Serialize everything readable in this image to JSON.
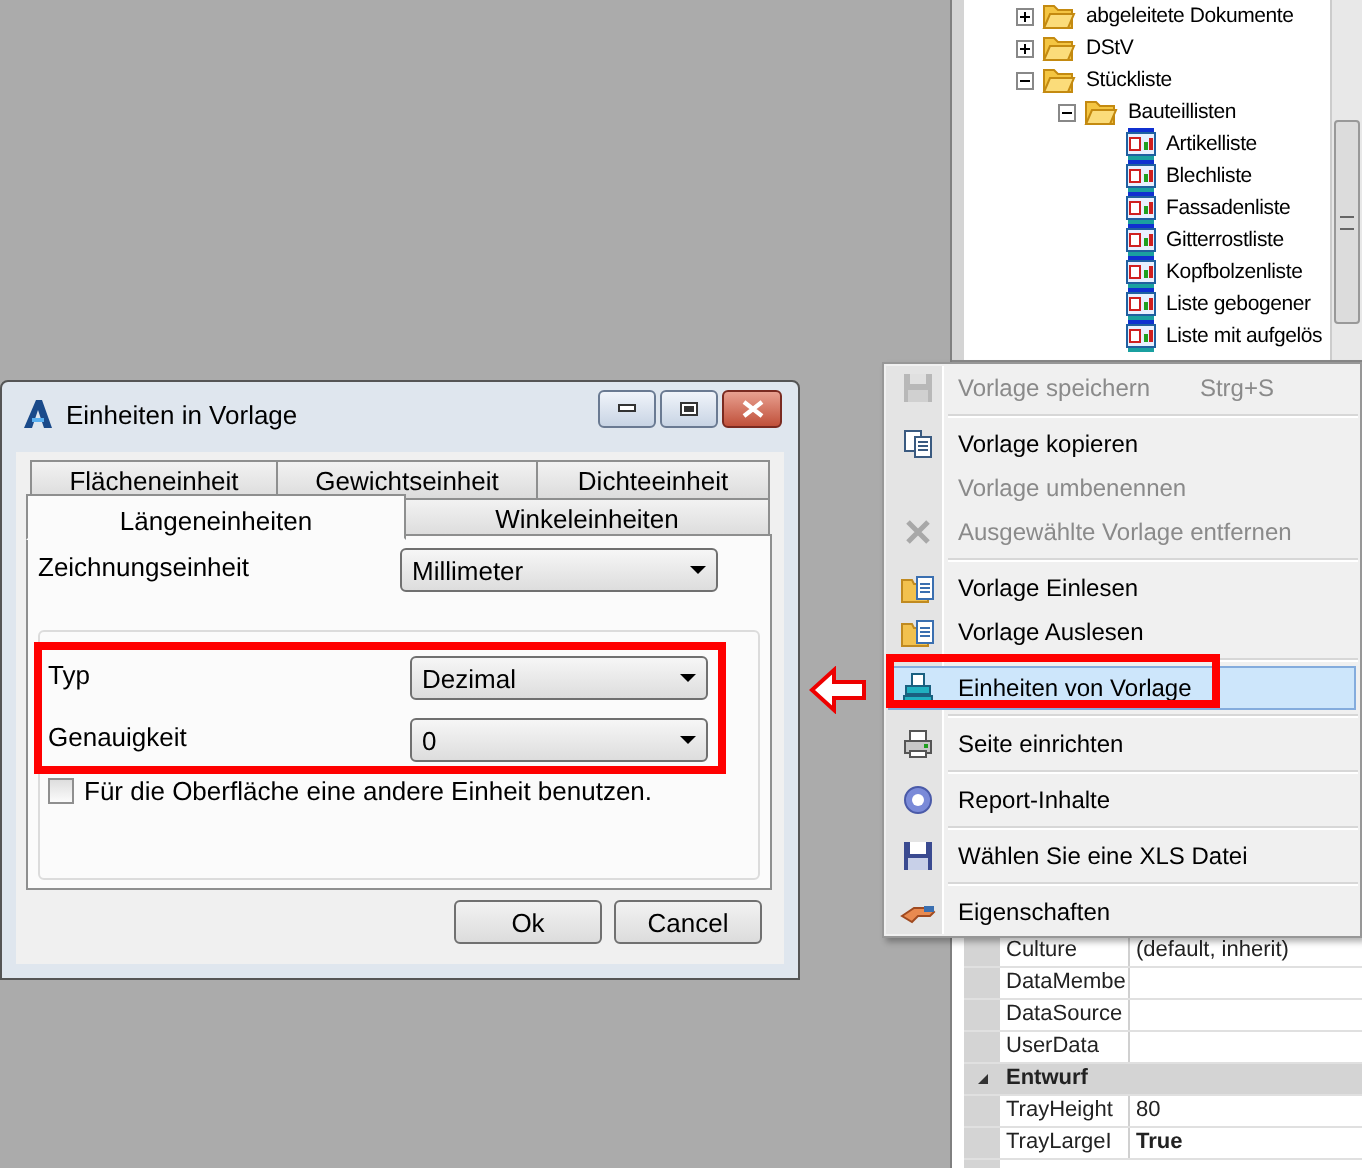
{
  "tree": {
    "items": [
      {
        "label": "abgeleitete Dokumente",
        "expanded": false
      },
      {
        "label": "DStV",
        "expanded": false
      },
      {
        "label": "Stückliste",
        "expanded": true,
        "children": [
          {
            "label": "Bauteillisten",
            "expanded": true,
            "children": [
              {
                "label": "Artikelliste"
              },
              {
                "label": "Blechliste"
              },
              {
                "label": "Fassadenliste"
              },
              {
                "label": "Gitterrostliste"
              },
              {
                "label": "Kopfbolzenliste"
              },
              {
                "label": "Liste gebogener"
              },
              {
                "label": "Liste mit aufgelös"
              }
            ]
          }
        ]
      }
    ]
  },
  "context_menu": {
    "items": [
      {
        "kind": "item",
        "label": "Vorlage speichern",
        "shortcut": "Strg+S",
        "disabled": true,
        "selected": false
      },
      {
        "kind": "separator"
      },
      {
        "kind": "item",
        "label": "Vorlage kopieren",
        "disabled": false,
        "selected": false
      },
      {
        "kind": "item",
        "label": "Vorlage umbenennen",
        "disabled": true,
        "selected": false
      },
      {
        "kind": "item",
        "label": "Ausgewählte Vorlage entfernen",
        "disabled": true,
        "selected": false
      },
      {
        "kind": "separator"
      },
      {
        "kind": "item",
        "label": "Vorlage Einlesen",
        "disabled": false,
        "selected": false
      },
      {
        "kind": "item",
        "label": "Vorlage Auslesen",
        "disabled": false,
        "selected": false
      },
      {
        "kind": "separator"
      },
      {
        "kind": "item",
        "label": "Einheiten von Vorlage",
        "disabled": false,
        "selected": true,
        "callout": true
      },
      {
        "kind": "separator"
      },
      {
        "kind": "item",
        "label": "Seite einrichten",
        "disabled": false,
        "selected": false
      },
      {
        "kind": "separator"
      },
      {
        "kind": "item",
        "label": "Report-Inhalte",
        "disabled": false,
        "selected": false
      },
      {
        "kind": "separator"
      },
      {
        "kind": "item",
        "label": "Wählen Sie eine XLS Datei",
        "disabled": false,
        "selected": false
      },
      {
        "kind": "separator"
      },
      {
        "kind": "item",
        "label": "Eigenschaften",
        "disabled": false,
        "selected": false
      }
    ]
  },
  "property_grid": {
    "rows": [
      {
        "kind": "property",
        "name": "Culture",
        "value": "(default, inherit)",
        "bold": false
      },
      {
        "kind": "property",
        "name": "DataMembe"
      },
      {
        "kind": "property",
        "name": "DataSource"
      },
      {
        "kind": "property",
        "name": "UserData"
      },
      {
        "kind": "category",
        "name": "Entwurf",
        "expanded": true
      },
      {
        "kind": "property",
        "name": "TrayHeight",
        "value": "80",
        "bold": false
      },
      {
        "kind": "property",
        "name": "TrayLargeI",
        "value": "True",
        "bold": true
      }
    ]
  },
  "dialog": {
    "title": "Einheiten in Vorlage",
    "tabs_back": [
      {
        "label": "Flächeneinheit",
        "selected": false
      },
      {
        "label": "Gewichtseinheit",
        "selected": false
      },
      {
        "label": "Dichteeinheit",
        "selected": false
      }
    ],
    "tabs_front": [
      {
        "label": "Längeneinheiten",
        "selected": true
      },
      {
        "label": "Winkeleinheiten",
        "selected": false
      }
    ],
    "drawing_unit": {
      "label": "Zeichnungseinheit",
      "value": "Millimeter"
    },
    "format_fields": [
      {
        "label": "Typ",
        "value": "Dezimal"
      },
      {
        "label": "Genauigkeit",
        "value": "0"
      }
    ],
    "format_callout": true,
    "checkbox": {
      "label": "Für die Oberfläche eine andere Einheit benutzen.",
      "checked": false
    },
    "buttons": [
      "Ok",
      "Cancel"
    ]
  },
  "callout_arrow": true
}
